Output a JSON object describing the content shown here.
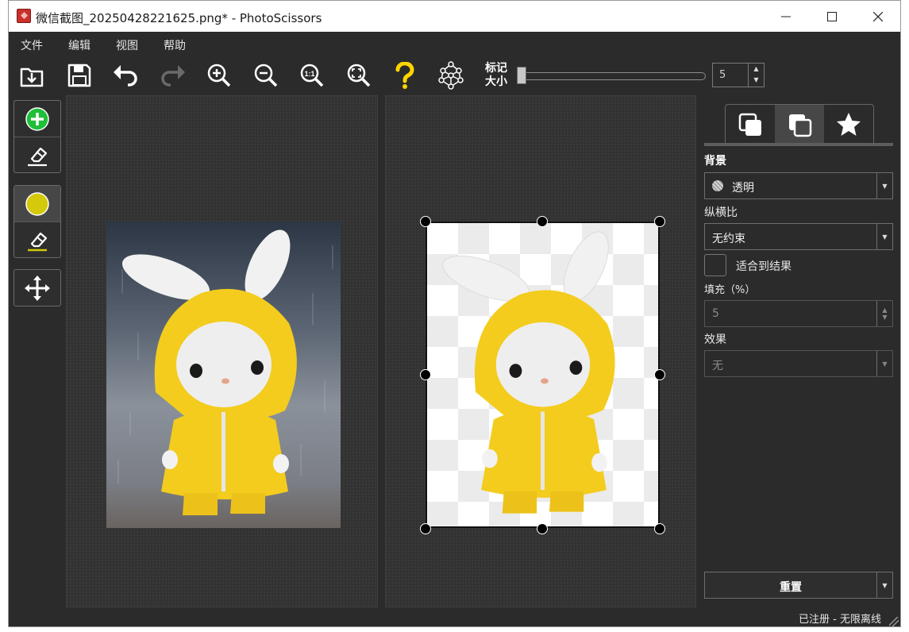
{
  "window": {
    "title": "微信截图_20250428221625.png* - PhotoScissors",
    "controls": [
      "minimize",
      "maximize",
      "close"
    ]
  },
  "menu": {
    "items": [
      "文件",
      "编辑",
      "视图",
      "帮助"
    ]
  },
  "toolbar": {
    "buttons": [
      "open-icon",
      "save-icon",
      "undo-icon",
      "redo-icon",
      "zoom-in-icon",
      "zoom-out-icon",
      "actual-size-icon",
      "fit-icon",
      "help-icon",
      "network-icon"
    ],
    "mark_size_label_line1": "标记",
    "mark_size_label_line2": "大小",
    "mark_size_value": "5",
    "mark_size_min": 0
  },
  "left_tools": {
    "groups": [
      [
        "add-foreground-icon",
        "eraser-icon"
      ],
      [
        "mark-background-icon",
        "eraser-background-icon"
      ],
      [
        "move-icon"
      ]
    ],
    "selected": "mark-background-icon",
    "foreground_color": "#1fbf3a",
    "background_color": "#d4c90a"
  },
  "right_panel": {
    "tabs": [
      "background-tab-icon",
      "crop-tab-icon",
      "effects-tab-icon"
    ],
    "selected_tab": 1,
    "background_label": "背景",
    "background_value": "透明",
    "aspect_label": "纵横比",
    "aspect_value": "无约束",
    "fit_result_label": "适合到结果",
    "fit_result_checked": false,
    "padding_label": "填充（%）",
    "padding_value": "5",
    "effect_label": "效果",
    "effect_value": "无",
    "reset_label": "重置"
  },
  "status": {
    "text": "已注册 - 无限离线"
  },
  "colors": {
    "dark_bg": "#2b2b2b",
    "raincoat_yellow": "#f3cc1e",
    "help_yellow": "#ffd400"
  }
}
